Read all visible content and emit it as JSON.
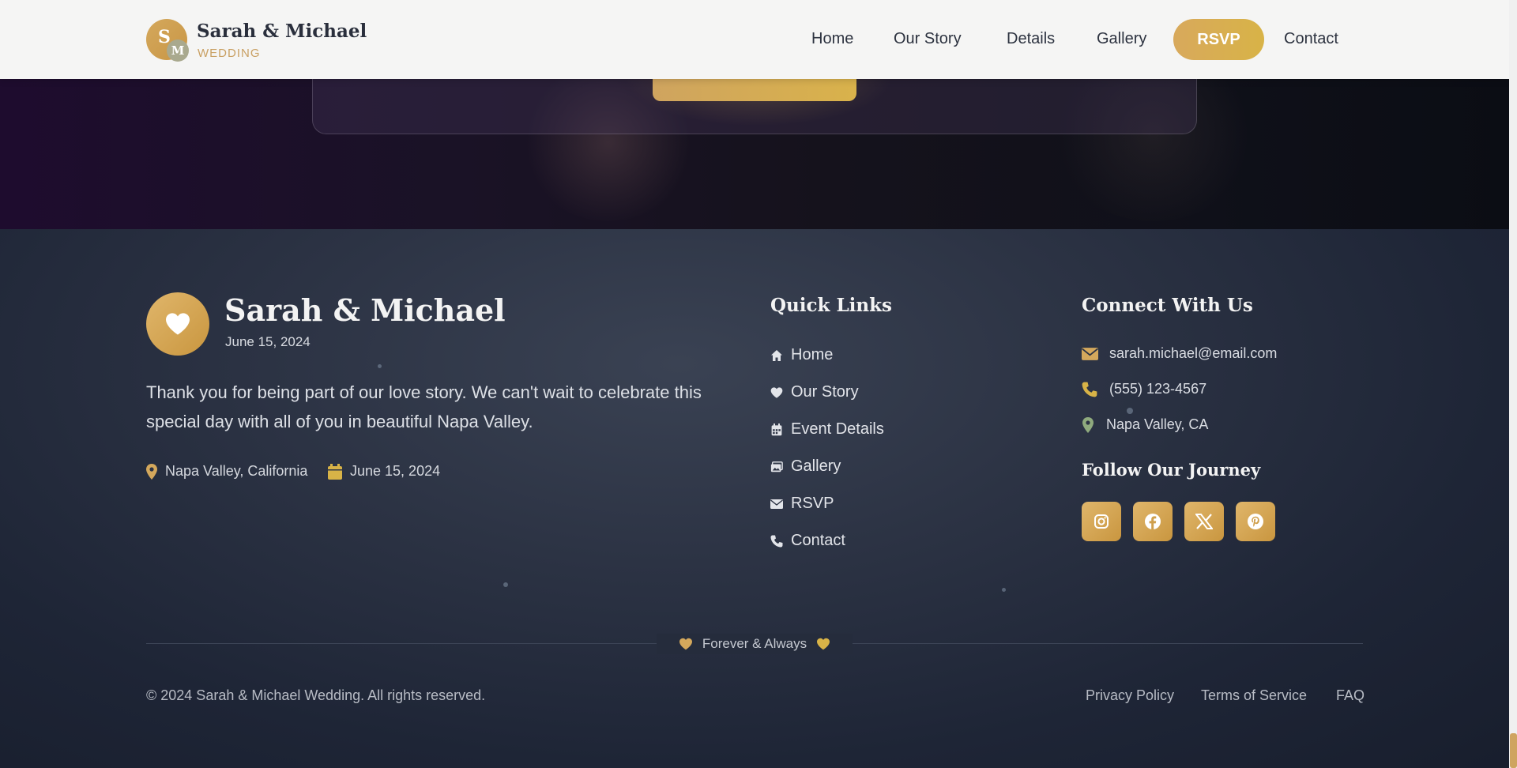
{
  "nav": {
    "brand_badge_initial_1": "S",
    "brand_badge_initial_2": "M",
    "brand_name": "Sarah & Michael",
    "brand_sub": "WEDDING",
    "items": [
      "Home",
      "Our Story",
      "Details",
      "Gallery",
      "RSVP",
      "Contact"
    ]
  },
  "footer": {
    "title": "Sarah & Michael",
    "date": "June 15, 2024",
    "message": "Thank you for being part of our love story. We can't wait to celebrate this special day with all of you in beautiful Napa Valley.",
    "meta_location": "Napa Valley, California",
    "meta_date": "June 15, 2024",
    "quick_links_heading": "Quick Links",
    "quick_links": [
      {
        "label": "Home",
        "icon": "home-icon"
      },
      {
        "label": "Our Story",
        "icon": "heart-icon"
      },
      {
        "label": "Event Details",
        "icon": "calendar-icon"
      },
      {
        "label": "Gallery",
        "icon": "images-icon"
      },
      {
        "label": "RSVP",
        "icon": "envelope-icon"
      },
      {
        "label": "Contact",
        "icon": "phone-icon"
      }
    ],
    "connect_heading": "Connect With Us",
    "email": "sarah.michael@email.com",
    "phone": "(555) 123-4567",
    "location": "Napa Valley, CA",
    "follow_heading": "Follow Our Journey",
    "socials": [
      "instagram-icon",
      "facebook-icon",
      "x-twitter-icon",
      "pinterest-icon"
    ],
    "divider_text": "Forever & Always",
    "copyright": "© 2024 Sarah & Michael Wedding. All rights reserved.",
    "legal_links": [
      "Privacy Policy",
      "Terms of Service",
      "FAQ"
    ]
  },
  "colors": {
    "accent_gold": "#d4a85c",
    "footer_bg": "#1e2536",
    "navbar_bg": "#f5f5f4"
  }
}
